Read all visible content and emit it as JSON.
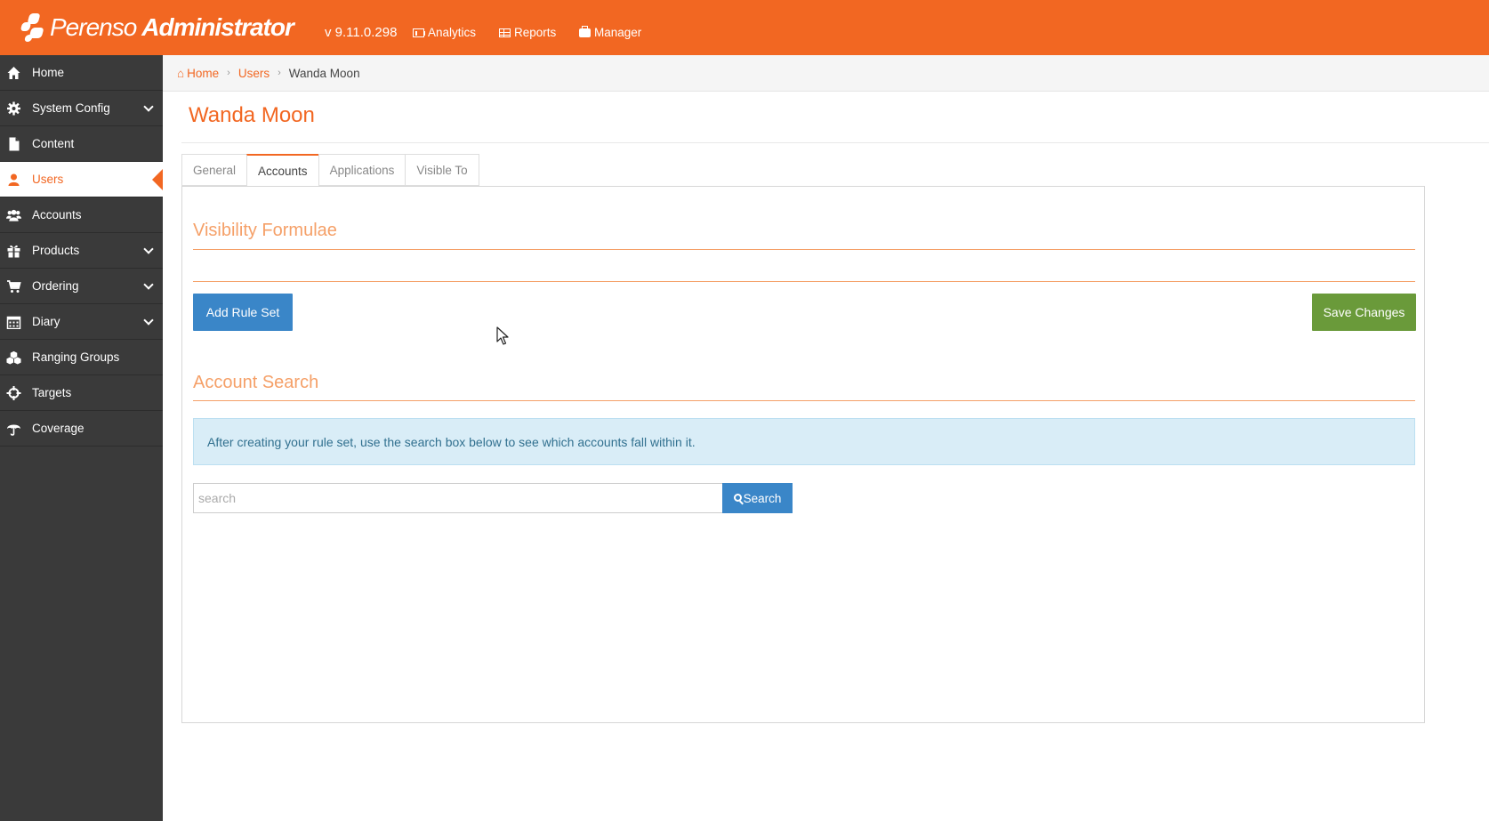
{
  "app": {
    "brand_light": "Perenso",
    "brand_bold": "Administrator",
    "version": "v 9.11.0.298",
    "topnav": [
      {
        "label": "Analytics",
        "icon": "analytics-icon"
      },
      {
        "label": "Reports",
        "icon": "table-icon"
      },
      {
        "label": "Manager",
        "icon": "briefcase-icon"
      }
    ],
    "accent_color": "#f26722"
  },
  "sidebar": {
    "items": [
      {
        "label": "Home",
        "icon": "home-icon",
        "has_submenu": false,
        "active": false
      },
      {
        "label": "System Config",
        "icon": "gear-icon",
        "has_submenu": true,
        "active": false
      },
      {
        "label": "Content",
        "icon": "document-icon",
        "has_submenu": false,
        "active": false
      },
      {
        "label": "Users",
        "icon": "user-icon",
        "has_submenu": false,
        "active": true
      },
      {
        "label": "Accounts",
        "icon": "users-icon",
        "has_submenu": false,
        "active": false
      },
      {
        "label": "Products",
        "icon": "gift-icon",
        "has_submenu": true,
        "active": false
      },
      {
        "label": "Ordering",
        "icon": "cart-icon",
        "has_submenu": true,
        "active": false
      },
      {
        "label": "Diary",
        "icon": "calendar-icon",
        "has_submenu": true,
        "active": false
      },
      {
        "label": "Ranging Groups",
        "icon": "cubes-icon",
        "has_submenu": false,
        "active": false
      },
      {
        "label": "Targets",
        "icon": "crosshairs-icon",
        "has_submenu": false,
        "active": false
      },
      {
        "label": "Coverage",
        "icon": "umbrella-icon",
        "has_submenu": false,
        "active": false
      }
    ]
  },
  "breadcrumb": {
    "items": [
      "Home",
      "Users",
      "Wanda Moon"
    ]
  },
  "page": {
    "title": "Wanda Moon",
    "tabs": [
      {
        "label": "General",
        "active": false
      },
      {
        "label": "Accounts",
        "active": true
      },
      {
        "label": "Applications",
        "active": false
      },
      {
        "label": "Visible To",
        "active": false
      }
    ]
  },
  "visibility": {
    "title": "Visibility Formulae",
    "add_rule_set_label": "Add Rule Set",
    "save_changes_label": "Save Changes"
  },
  "account_search": {
    "title": "Account Search",
    "info_text": "After creating your rule set, use the search box below to see which accounts fall within it.",
    "search_placeholder": "search",
    "search_value": "",
    "search_button_label": "Search"
  }
}
